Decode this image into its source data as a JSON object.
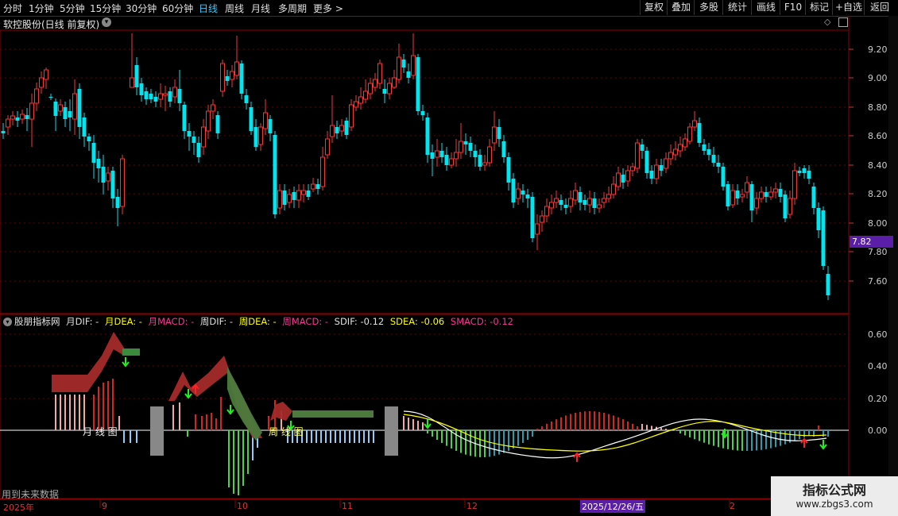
{
  "toolbar": {
    "periods": [
      {
        "label": "分时"
      },
      {
        "label": "1分钟"
      },
      {
        "label": "5分钟"
      },
      {
        "label": "15分钟"
      },
      {
        "label": "30分钟"
      },
      {
        "label": "60分钟"
      },
      {
        "label": "日线",
        "active": true
      },
      {
        "label": "周线"
      },
      {
        "label": "月线"
      },
      {
        "label": "多周期"
      },
      {
        "label": "更多 >"
      }
    ],
    "right_buttons": [
      "复权",
      "叠加",
      "多股",
      "统计",
      "画线",
      "F10",
      "标记",
      "+自选",
      "返回"
    ]
  },
  "main_chart": {
    "title": "软控股份(日线 前复权)",
    "y_ticks": [
      "9.20",
      "9.00",
      "8.80",
      "8.60",
      "8.40",
      "8.20",
      "8.00",
      "7.80",
      "7.60"
    ],
    "last_price": "7.82",
    "colors": {
      "up": "#ff3333",
      "down": "#00e5ee",
      "grid": "#8b0000",
      "price_tag": "#5a1ea8"
    }
  },
  "indicator": {
    "name": "股朋指标网",
    "items": [
      {
        "label": "月DIF: -",
        "color": "#e0e0e0"
      },
      {
        "label": "月DEA: -",
        "color": "#ffff00"
      },
      {
        "label": "月MACD: -",
        "color": "#ff3399"
      },
      {
        "label": "周DIF: -",
        "color": "#e0e0e0"
      },
      {
        "label": "周DEA: -",
        "color": "#ffff00"
      },
      {
        "label": "周MACD: -",
        "color": "#ff3399"
      },
      {
        "label": "SDIF: -0.12",
        "color": "#e0e0e0"
      },
      {
        "label": "SDEA: -0.06",
        "color": "#ffff00"
      },
      {
        "label": "SMACD: -0.12",
        "color": "#ff3399"
      }
    ],
    "y_ticks": [
      "0.60",
      "0.40",
      "0.20",
      "0.00"
    ],
    "month_label": "月 线 图",
    "week_label": "周 线 图",
    "note": "用到未来数据"
  },
  "time_axis": {
    "labels": [
      "2025年",
      "9",
      "10",
      "11",
      "12",
      "2025/12/26/五",
      "2"
    ]
  },
  "watermark": {
    "line1": "指标公式网",
    "line2": "www.zbgs3.com"
  }
}
